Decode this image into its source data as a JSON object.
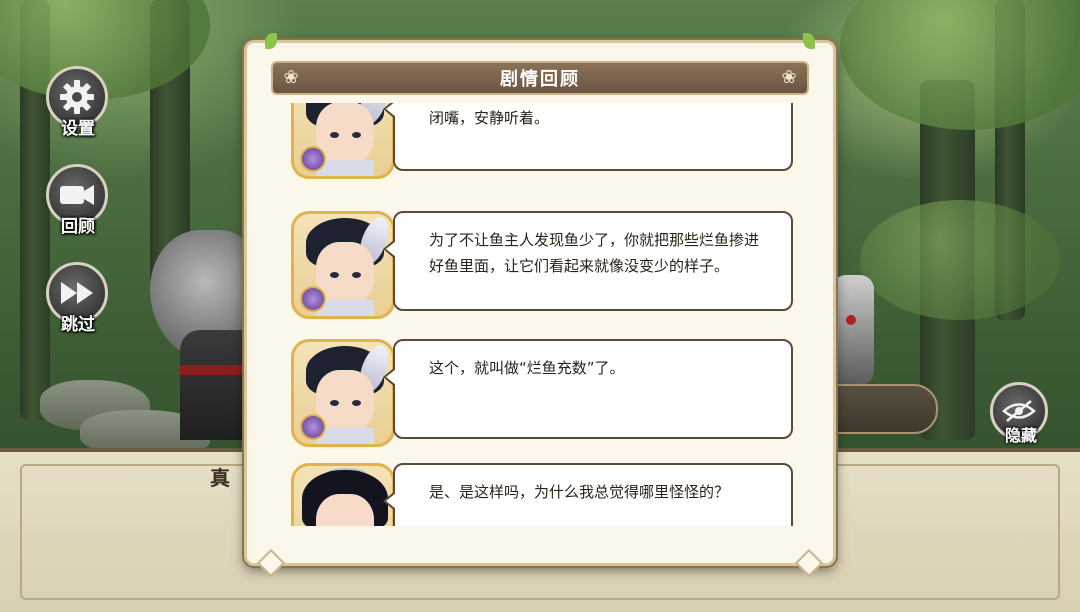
{
  "side_buttons": {
    "settings": {
      "label": "设置",
      "icon": "gear-icon"
    },
    "review": {
      "label": "回顾",
      "icon": "camera-icon"
    },
    "skip": {
      "label": "跳过",
      "icon": "fast-forward-icon"
    }
  },
  "hide_button": {
    "label": "隐藏",
    "icon": "eye-off-icon"
  },
  "dialogue": {
    "speaker": "真"
  },
  "panel": {
    "title": "剧情回顾",
    "entries": [
      {
        "speaker_avatar": "boy",
        "text": "闭嘴，安静听着。"
      },
      {
        "speaker_avatar": "boy",
        "text": "为了不让鱼主人发现鱼少了，你就把那些烂鱼掺进好鱼里面，让它们看起来就像没变少的样子。"
      },
      {
        "speaker_avatar": "boy",
        "text": "这个，就叫做“烂鱼充数”了。"
      },
      {
        "speaker_avatar": "girl",
        "text": "是、是这样吗，为什么我总觉得哪里怪怪的？"
      }
    ]
  },
  "colors": {
    "panel_bg": "#fbf7ea",
    "header_bg": "#7a634b",
    "avatar_frame": "#e2b24c",
    "bubble_border": "#5b4a3a"
  }
}
